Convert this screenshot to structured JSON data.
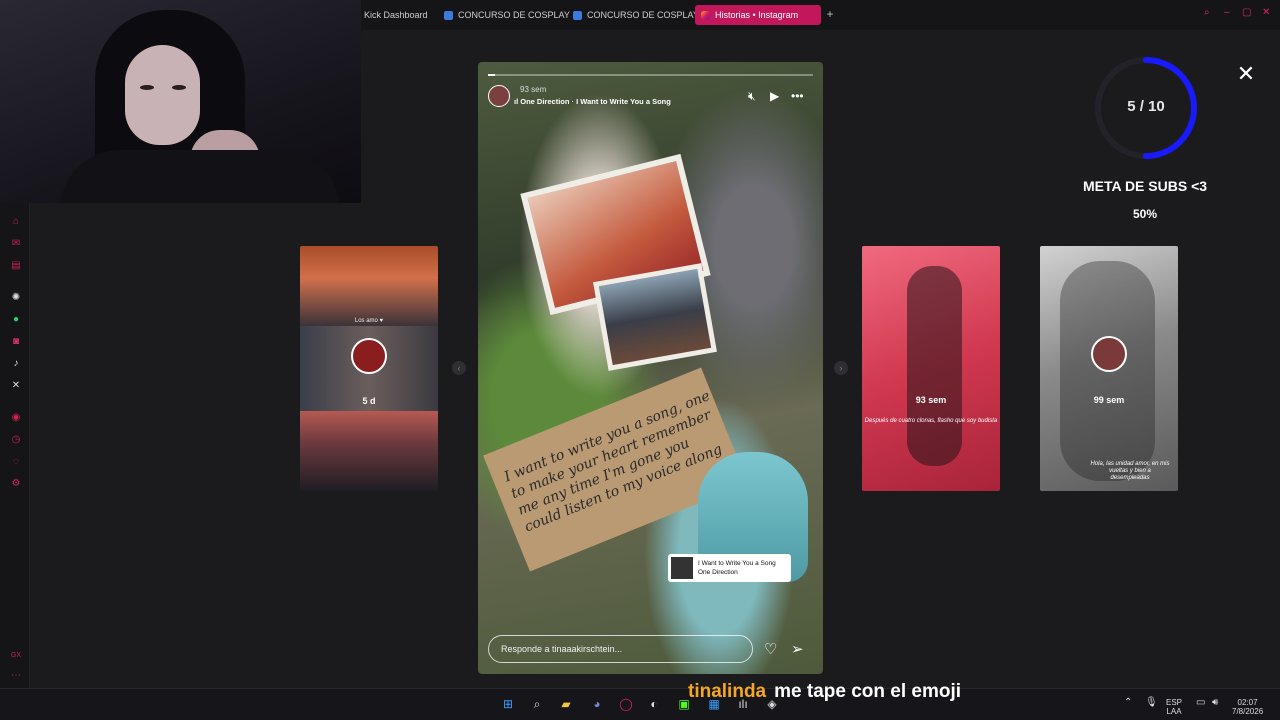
{
  "browser": {
    "tabs": [
      {
        "label": "Kick Dashboard",
        "active": false
      },
      {
        "label": "CONCURSO DE COSPLAY",
        "active": false
      },
      {
        "label": "CONCURSO DE COSPLAY",
        "active": false
      },
      {
        "label": "Historias • Instagram",
        "active": true
      }
    ],
    "new_tab": "+",
    "toolbar_ai": "AI"
  },
  "story": {
    "time": "93 sem",
    "song": "One Direction · I Want to Write You a Song",
    "progress": 0.02,
    "handwriting": "I want to write you a song, one to make your heart remember me any time I'm gone you could listen to my voice along",
    "music_card": {
      "title": "I Want to Write You a Song",
      "artist": "One Direction"
    },
    "reply_placeholder": "Responde a tinaaakirschtein..."
  },
  "thumbs": [
    {
      "label": "5 d",
      "sublabel": "Los amo ♥"
    },
    {
      "label": "93 sem",
      "caption": "Después de cuatro clonas, flasho que soy budista"
    },
    {
      "label": "99 sem",
      "caption": "Hola, las unidad amor, en mis vueltas y bien a desempleadas"
    }
  ],
  "goal": {
    "current": 5,
    "target": 10,
    "count_text": "5 / 10",
    "title": "META DE SUBS <3",
    "percent_text": "50%",
    "ring_color": "#1a1aff"
  },
  "chat": {
    "user": "tinalinda",
    "message": "me tape con el emoji"
  },
  "tray": {
    "lang": "ESP",
    "region": "LAA",
    "time": "02:07",
    "date": "7/8/2026"
  },
  "colors": {
    "accent": "#d02050",
    "tab_active": "#c2185b",
    "chat_user": "#f5a623"
  }
}
